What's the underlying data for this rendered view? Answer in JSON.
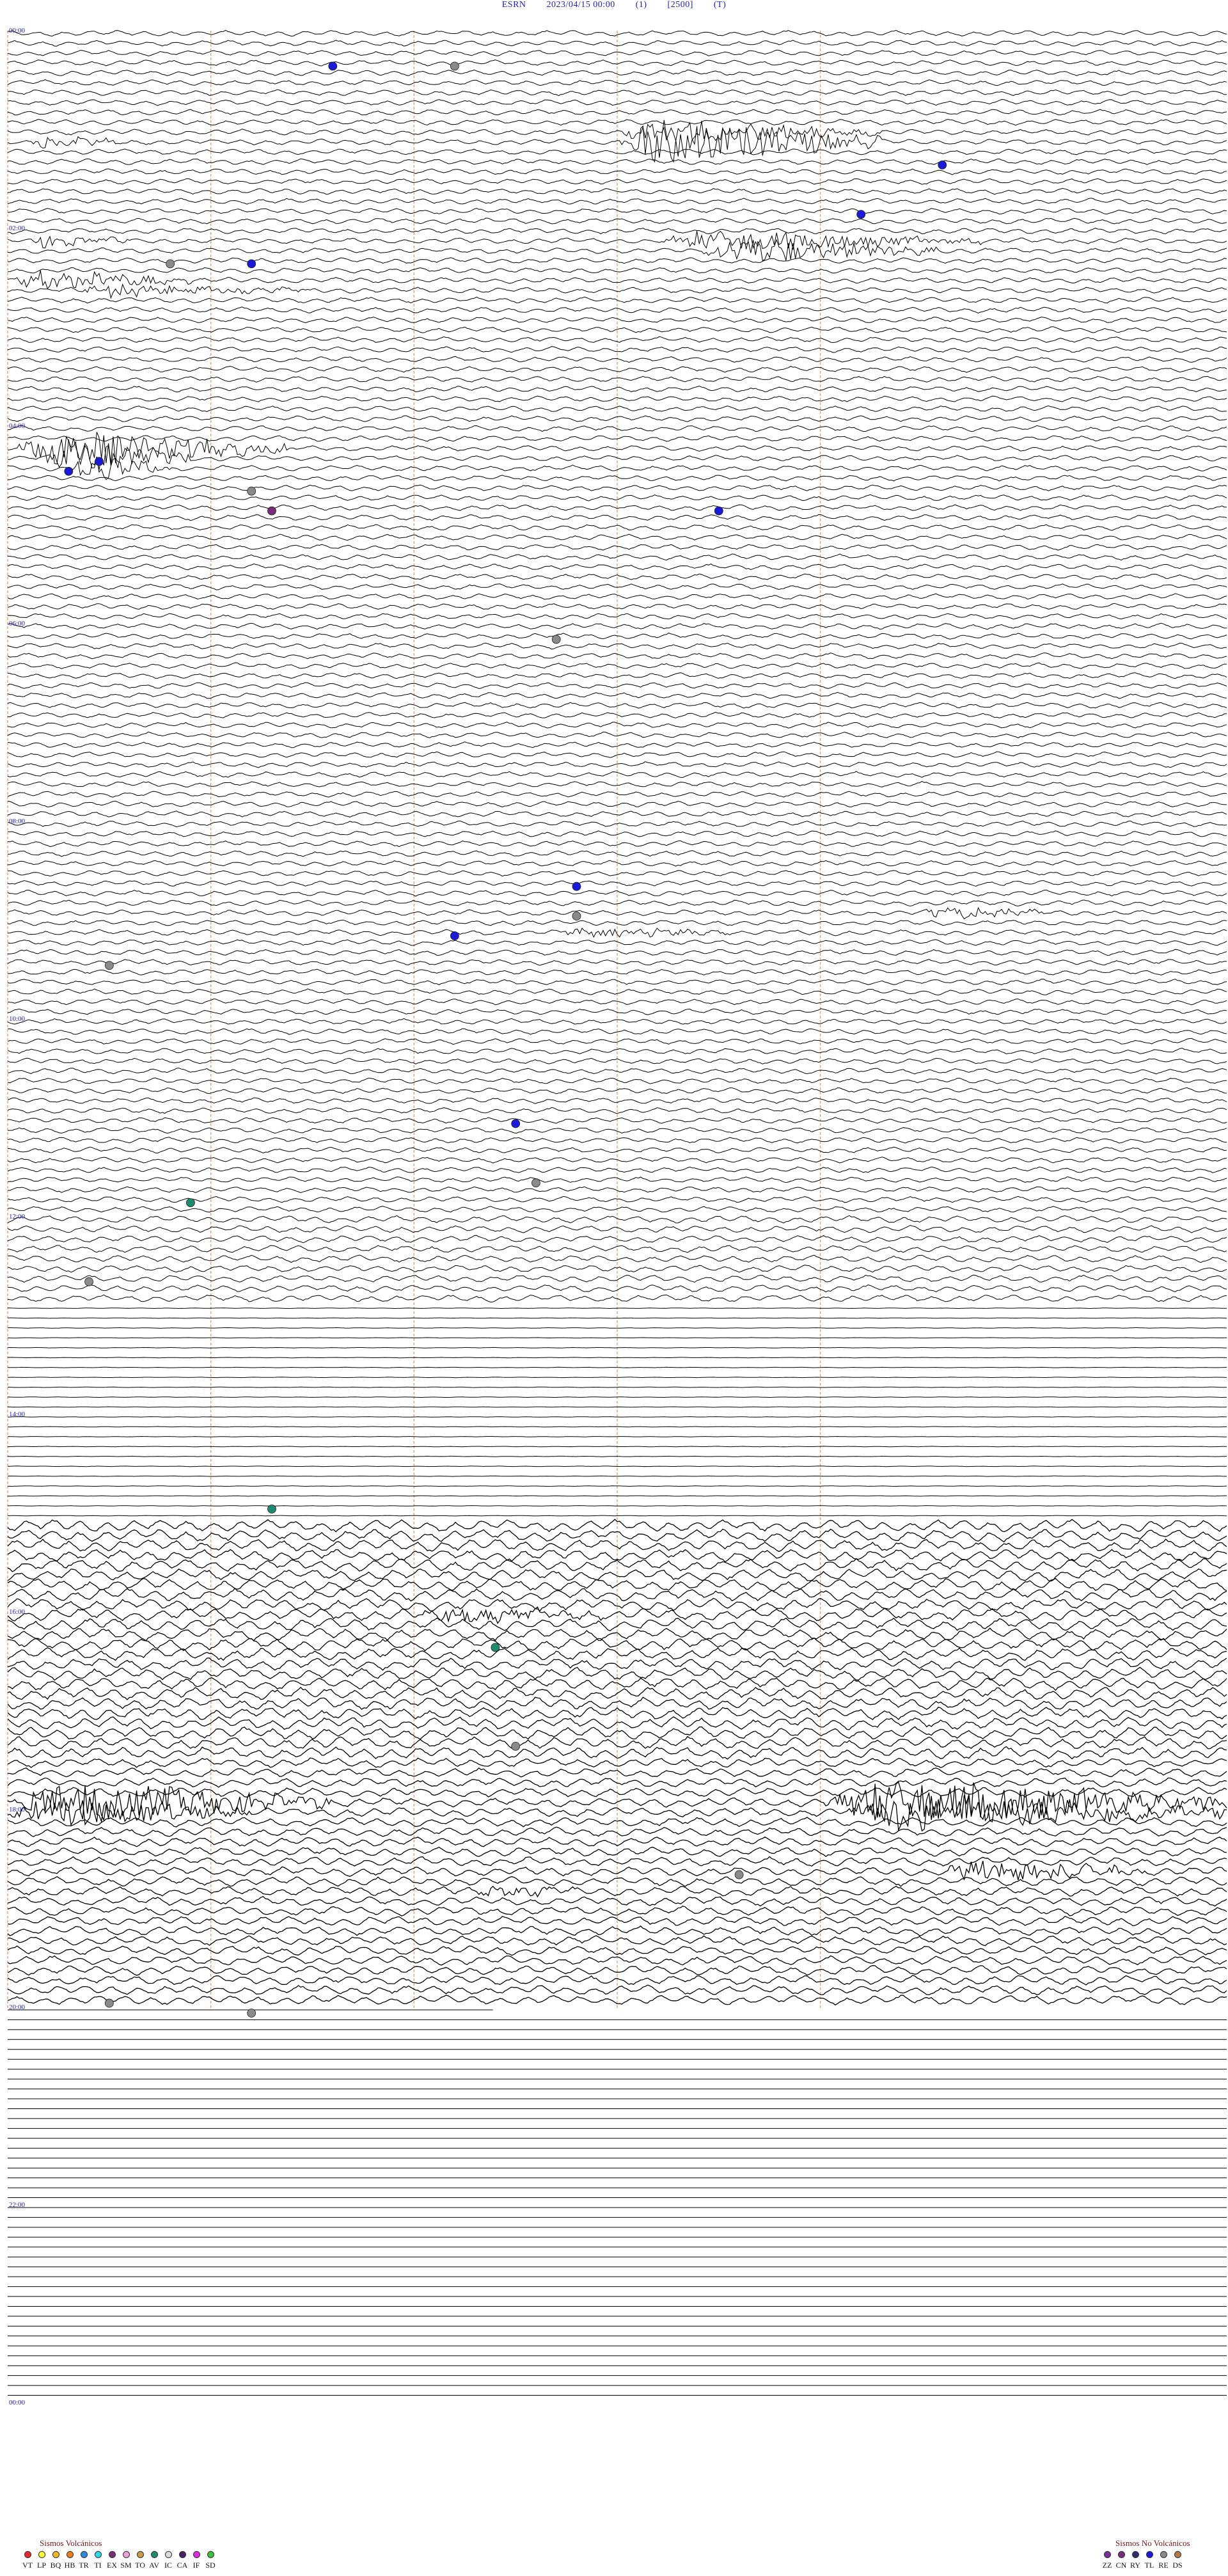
{
  "header": {
    "station": "ESRN",
    "datetime": "2023/04/15 00:00",
    "p1": "(1)",
    "p2": "[2500]",
    "p3": "(T)"
  },
  "chart_data": {
    "type": "helicorder",
    "title": "ESRN 2023/04/15 00:00 (1) [2500] (T)",
    "hour_labels": [
      "00:00",
      "02:00",
      "04:00",
      "06:00",
      "08:00",
      "10:00",
      "12:00",
      "14:00",
      "16:00",
      "18:00",
      "20:00",
      "22:00",
      "00:00"
    ],
    "lines_per_hour": 10,
    "line_minutes": 6,
    "events": [
      {
        "line": 3,
        "minute": 1.6,
        "class": "TL"
      },
      {
        "line": 13,
        "minute": 4.6,
        "class": "TL"
      },
      {
        "line": 18,
        "minute": 4.2,
        "class": "TL"
      },
      {
        "line": 23,
        "minute": 1.2,
        "class": "TL"
      },
      {
        "line": 43,
        "minute": 0.45,
        "class": "TL"
      },
      {
        "line": 44,
        "minute": 0.3,
        "class": "TL"
      },
      {
        "line": 48,
        "minute": 3.5,
        "class": "TL"
      },
      {
        "line": 86,
        "minute": 2.8,
        "class": "TL"
      },
      {
        "line": 91,
        "minute": 2.2,
        "class": "TL"
      },
      {
        "line": 110,
        "minute": 2.5,
        "class": "TL"
      },
      {
        "line": 126,
        "minute": 0.4,
        "class": "RE"
      },
      {
        "line": 3,
        "minute": 2.2,
        "class": "RE"
      },
      {
        "line": 23,
        "minute": 0.8,
        "class": "RE"
      },
      {
        "line": 46,
        "minute": 1.2,
        "class": "RE"
      },
      {
        "line": 48,
        "minute": 1.3,
        "class": "EX"
      },
      {
        "line": 61,
        "minute": 2.7,
        "class": "RE"
      },
      {
        "line": 89,
        "minute": 2.8,
        "class": "RE"
      },
      {
        "line": 94,
        "minute": 0.5,
        "class": "RE"
      },
      {
        "line": 116,
        "minute": 2.6,
        "class": "RE"
      },
      {
        "line": 118,
        "minute": 0.9,
        "class": "AV"
      },
      {
        "line": 149,
        "minute": 1.3,
        "class": "AV"
      },
      {
        "line": 163,
        "minute": 2.4,
        "class": "AV"
      },
      {
        "line": 173,
        "minute": 2.5,
        "class": "RE"
      },
      {
        "line": 186,
        "minute": 3.6,
        "class": "RE"
      },
      {
        "line": 199,
        "minute": 0.5,
        "class": "RE"
      },
      {
        "line": 200,
        "minute": 1.2,
        "class": "RE"
      }
    ]
  },
  "legend": {
    "volcanic_title": "Sismos Volcánicos",
    "volcanic": [
      {
        "code": "VT",
        "color": "#e8282b"
      },
      {
        "code": "LP",
        "color": "#ffff33"
      },
      {
        "code": "BQ",
        "color": "#f2b824"
      },
      {
        "code": "HB",
        "color": "#f07d1e"
      },
      {
        "code": "TR",
        "color": "#2f8de0"
      },
      {
        "code": "TI",
        "color": "#2fd8e8"
      },
      {
        "code": "EX",
        "color": "#7a2e7a"
      },
      {
        "code": "SM",
        "color": "#f0a0d8"
      },
      {
        "code": "TO",
        "color": "#c89a4a"
      },
      {
        "code": "AV",
        "color": "#1e8a70"
      },
      {
        "code": "IC",
        "color": "#dcdcdc"
      },
      {
        "code": "CA",
        "color": "#4b1f6b"
      },
      {
        "code": "IF",
        "color": "#e02ae0"
      },
      {
        "code": "SD",
        "color": "#3fbf3f"
      }
    ],
    "nonvolcanic_title": "Sismos No Volcánicos",
    "nonvolcanic": [
      {
        "code": "ZZ",
        "color": "#7a2e9a"
      },
      {
        "code": "CN",
        "color": "#7a2e7a"
      },
      {
        "code": "RY",
        "color": "#2f2f6b"
      },
      {
        "code": "TL",
        "color": "#1a1ad8"
      },
      {
        "code": "RE",
        "color": "#8a8a8a"
      },
      {
        "code": "DS",
        "color": "#b07a4a"
      }
    ]
  }
}
